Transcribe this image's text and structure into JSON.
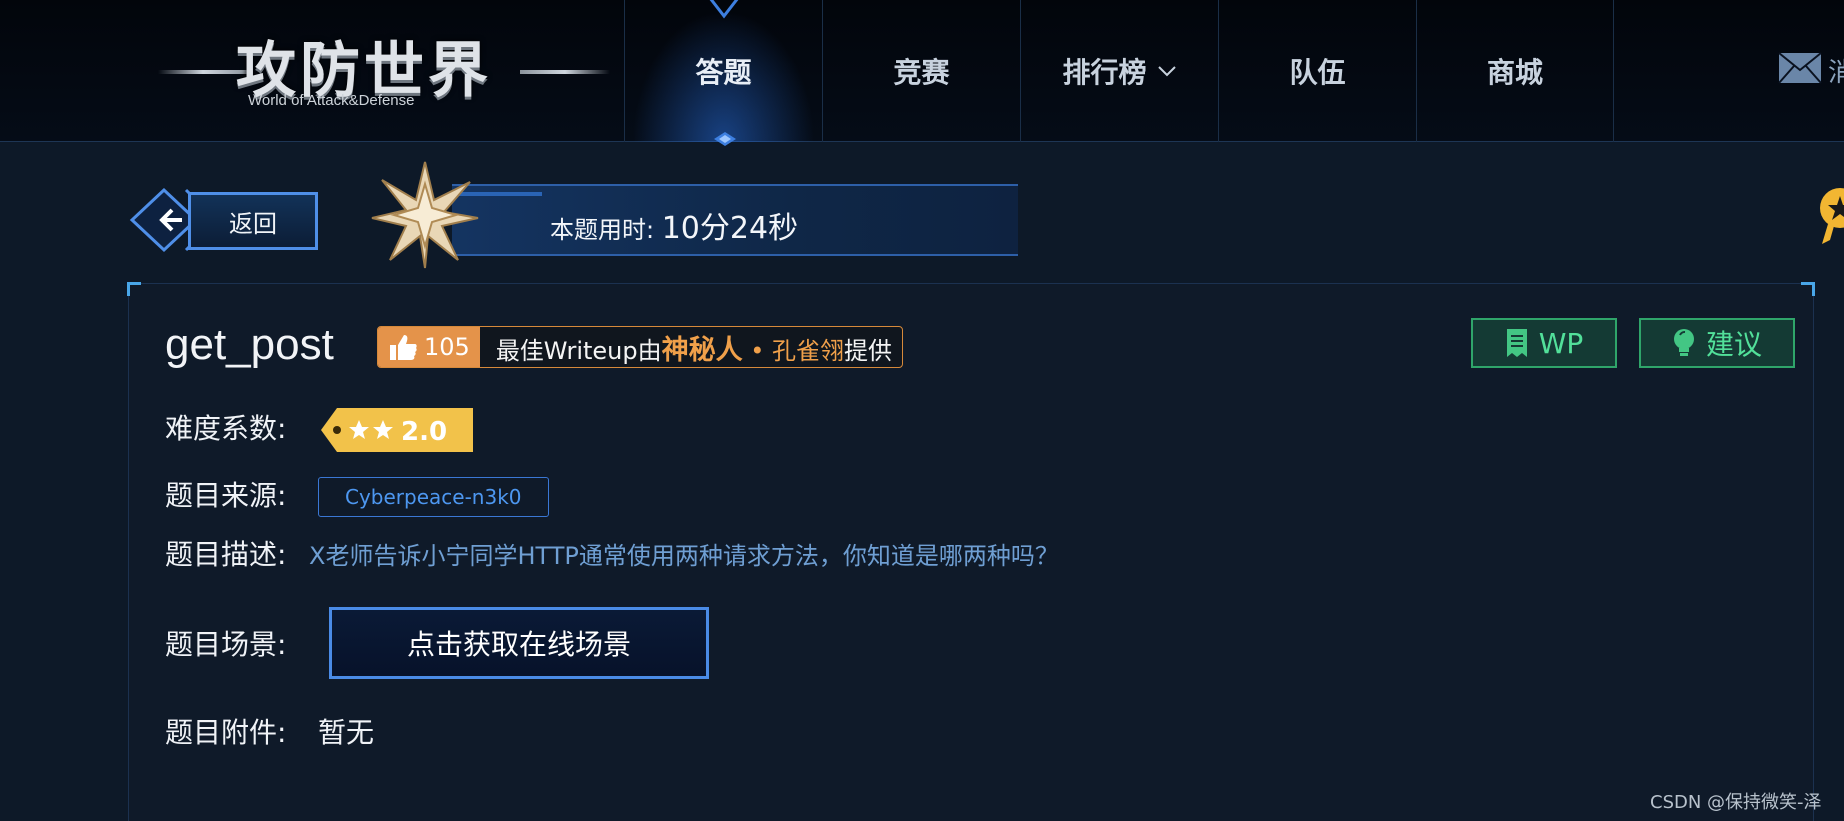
{
  "header": {
    "logo_text": "攻防世界",
    "logo_sub": "World of Attack&Defense",
    "nav": [
      {
        "label": "答题",
        "active": true
      },
      {
        "label": "竞赛",
        "active": false
      },
      {
        "label": "排行榜",
        "active": false,
        "has_dropdown": true
      },
      {
        "label": "队伍",
        "active": false
      },
      {
        "label": "商城",
        "active": false
      }
    ],
    "message_label": "消"
  },
  "subbar": {
    "back_label": "返回",
    "timer_label": "本题用时: ",
    "timer_value": "10分24秒"
  },
  "challenge": {
    "title": "get_post",
    "writeup": {
      "likes": "105",
      "prefix": "最佳Writeup由",
      "name": "神秘人",
      "dot": " • ",
      "author": "孔雀翎",
      "suffix": "提供"
    },
    "wp_label": "WP",
    "suggest_label": "建议",
    "difficulty_label": "难度系数:",
    "difficulty_value": "2.0",
    "difficulty_stars": 2,
    "source_label": "题目来源:",
    "source_value": "Cyberpeace-n3k0",
    "desc_label": "题目描述:",
    "desc_value": "X老师告诉小宁同学HTTP通常使用两种请求方法，你知道是哪两种吗？",
    "scene_label": "题目场景:",
    "scene_button": "点击获取在线场景",
    "attach_label": "题目附件:",
    "attach_value": "暂无"
  },
  "watermark": "CSDN @保持微笑-泽",
  "colors": {
    "accent_blue": "#4a8be6",
    "writeup_orange": "#e4934a",
    "green": "#52e09a",
    "background": "#0d1928"
  }
}
